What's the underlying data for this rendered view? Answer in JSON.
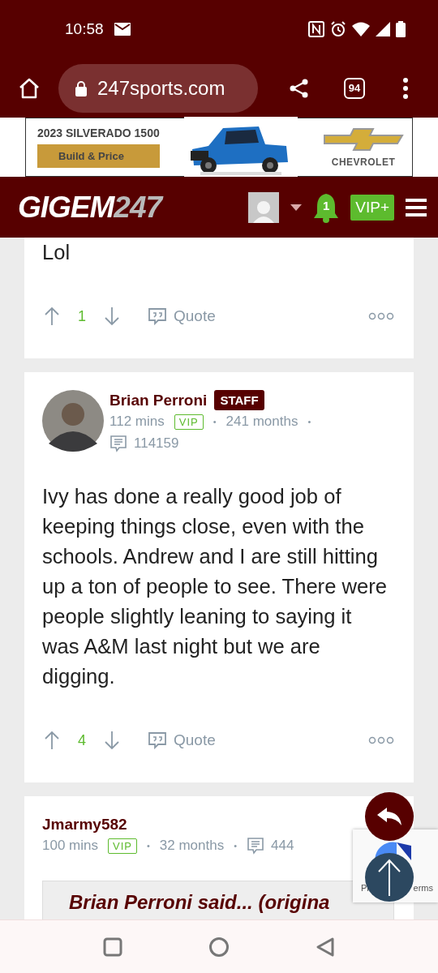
{
  "status_bar": {
    "time": "10:58"
  },
  "browser": {
    "url": "247sports.com",
    "tab_count": "94"
  },
  "ad": {
    "title": "2023 SILVERADO 1500",
    "button": "Build & Price",
    "brand": "CHEVROLET"
  },
  "site_header": {
    "logo_main": "GIGEM",
    "logo_number": "247",
    "notification_count": "1",
    "vip_button": "VIP+"
  },
  "posts": [
    {
      "kind": "tail",
      "body": "Lol",
      "votes": "1",
      "quote_label": "Quote"
    },
    {
      "kind": "full",
      "author": "Brian Perroni",
      "role": "STAFF",
      "avatar": true,
      "time": "112 mins",
      "badge": "VIP",
      "separators": [
        "•",
        "•"
      ],
      "tenure": "241 months",
      "post_count": "114159",
      "body": "Ivy has done a really good job of keeping things close, even with the schools. Andrew and I are still hitting up a ton of people to see. There were people slightly leaning to saying it was A&M last night but we are digging.",
      "votes": "4",
      "quote_label": "Quote"
    },
    {
      "kind": "head",
      "author": "Jmarmy582",
      "avatar": false,
      "time": "100 mins",
      "badge": "VIP",
      "separators": [
        "•",
        "•"
      ],
      "tenure": "32 months",
      "post_count": "444",
      "quote_title": "Brian Perroni said... (origina"
    }
  ],
  "recaptcha": {
    "left": "Pr",
    "right": "erms"
  }
}
